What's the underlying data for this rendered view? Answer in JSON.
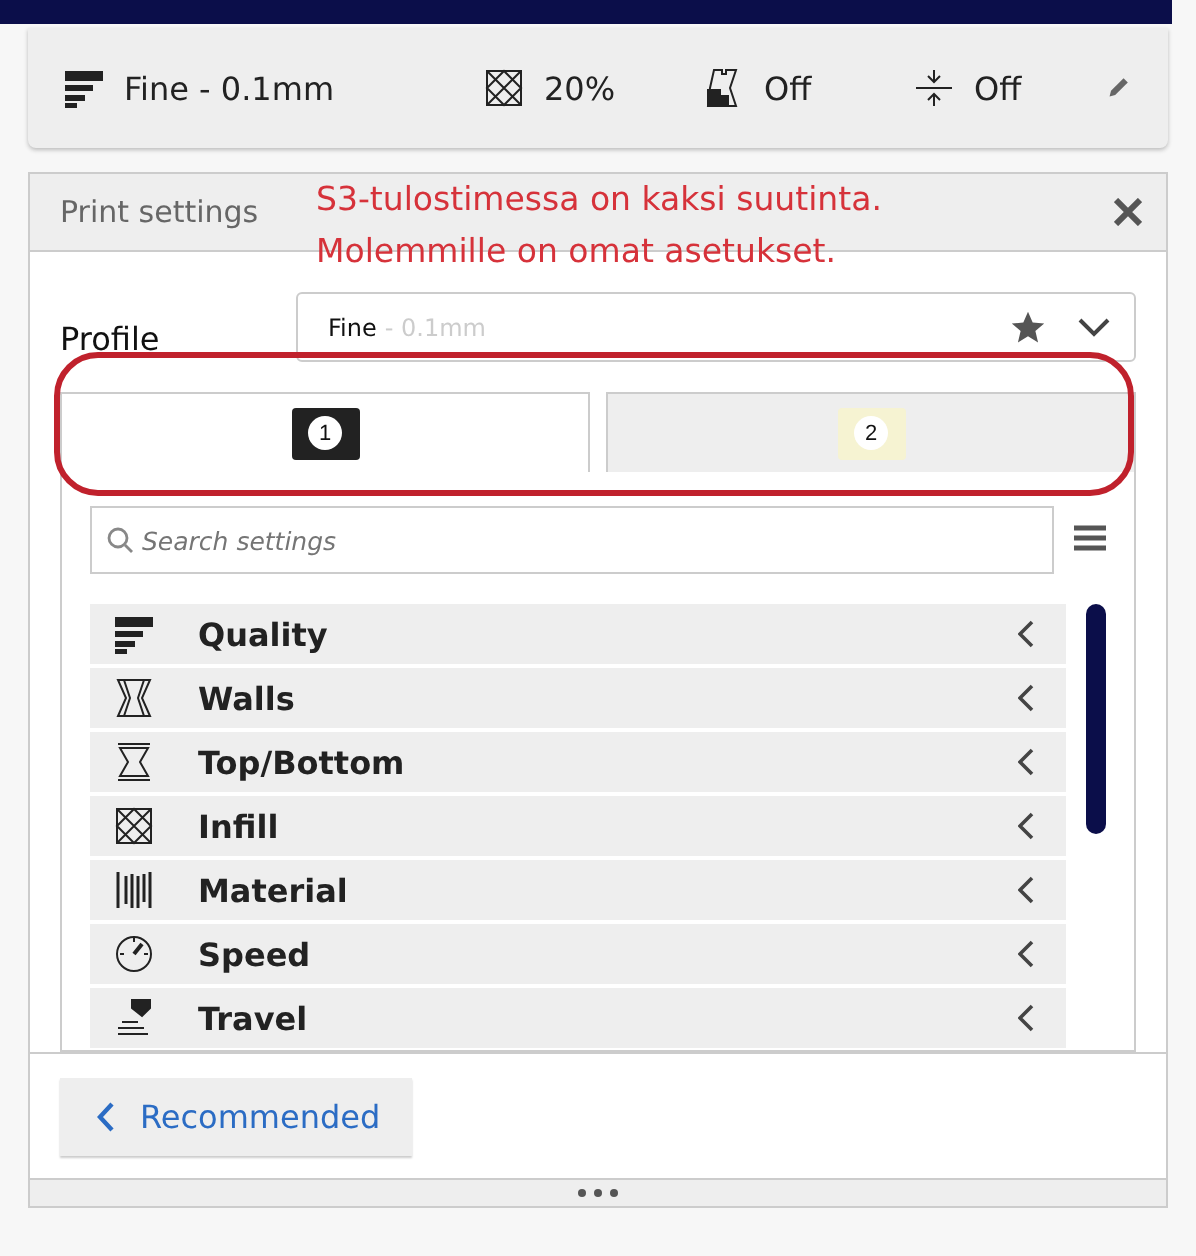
{
  "summary_bar": {
    "quality": "Fine - 0.1mm",
    "infill": "20%",
    "support": "Off",
    "adhesion": "Off"
  },
  "panel": {
    "title": "Print settings",
    "annotation": [
      "S3-tulostimessa on kaksi suutinta.",
      "Molemmille on omat asetukset."
    ],
    "profile": {
      "label": "Profile",
      "name": "Fine",
      "detail": " - 0.1mm"
    },
    "extruder_tabs": [
      {
        "label": "1",
        "selected": true,
        "color": "#222222"
      },
      {
        "label": "2",
        "selected": false,
        "color": "#f6f3d2"
      }
    ],
    "search": {
      "placeholder": "Search settings"
    },
    "categories": [
      {
        "kind": "quality",
        "label": "Quality"
      },
      {
        "kind": "walls",
        "label": "Walls"
      },
      {
        "kind": "topbottom",
        "label": "Top/Bottom"
      },
      {
        "kind": "infill",
        "label": "Infill"
      },
      {
        "kind": "material",
        "label": "Material"
      },
      {
        "kind": "speed",
        "label": "Speed"
      },
      {
        "kind": "travel",
        "label": "Travel"
      }
    ],
    "mode_button": "Recommended"
  }
}
